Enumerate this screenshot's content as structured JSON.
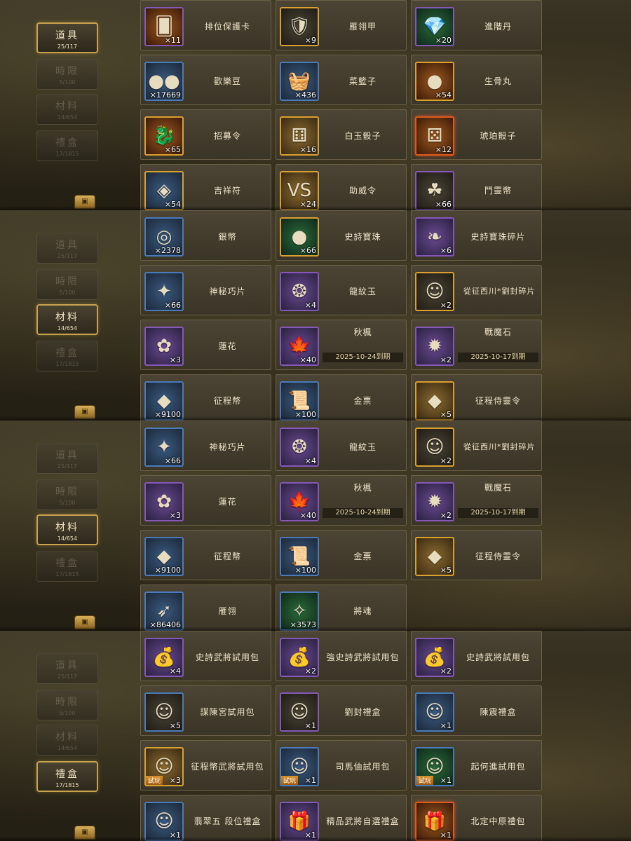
{
  "panels": [
    {
      "tabs": [
        {
          "label": "道具",
          "count": "25/117"
        },
        {
          "label": "時限",
          "count": "5/100"
        },
        {
          "label": "材料",
          "count": "14/654"
        },
        {
          "label": "禮盒",
          "count": "17/1815"
        }
      ],
      "active_tab": 0,
      "items": [
        {
          "name": "排位保護卡",
          "qty": "×11",
          "icon": "card-icon",
          "glyph": "🂠",
          "quality": "purple",
          "bg": "red"
        },
        {
          "name": "雁翎甲",
          "qty": "×9",
          "icon": "armor-icon",
          "glyph": "🛡",
          "quality": "gold",
          "bg": "dark"
        },
        {
          "name": "進階丹",
          "qty": "×20",
          "icon": "pill-icon",
          "glyph": "💎",
          "quality": "purple",
          "bg": "green"
        },
        {
          "name": "歡樂豆",
          "qty": "×17669",
          "icon": "beans-icon",
          "glyph": "●●",
          "quality": "blue",
          "bg": "blue"
        },
        {
          "name": "菜籃子",
          "qty": "×436",
          "icon": "basket-icon",
          "glyph": "🧺",
          "quality": "blue",
          "bg": "blue"
        },
        {
          "name": "生骨丸",
          "qty": "×54",
          "icon": "orb-icon",
          "glyph": "●",
          "quality": "gold",
          "bg": "red"
        },
        {
          "name": "招募令",
          "qty": "×65",
          "icon": "recruit-icon",
          "glyph": "🐉",
          "quality": "gold",
          "bg": "red"
        },
        {
          "name": "白玉骰子",
          "qty": "×16",
          "icon": "white-dice-icon",
          "glyph": "⚅",
          "quality": "gold",
          "bg": "gold"
        },
        {
          "name": "琥珀骰子",
          "qty": "×12",
          "icon": "amber-dice-icon",
          "glyph": "⚄",
          "quality": "red",
          "bg": "red"
        },
        {
          "name": "吉祥符",
          "qty": "×54",
          "icon": "charm-icon",
          "glyph": "◈",
          "quality": "gold",
          "bg": "blue"
        },
        {
          "name": "助威令",
          "qty": "×24",
          "icon": "vs-icon",
          "glyph": "VS",
          "quality": "gold",
          "bg": "gold"
        },
        {
          "name": "鬥靈幣",
          "qty": "×66",
          "icon": "spirit-coin-icon",
          "glyph": "☘",
          "quality": "purple",
          "bg": "dark"
        }
      ]
    },
    {
      "tabs": [
        {
          "label": "道具",
          "count": "25/117"
        },
        {
          "label": "時限",
          "count": "5/100"
        },
        {
          "label": "材料",
          "count": "14/654"
        },
        {
          "label": "禮盒",
          "count": "17/1815"
        }
      ],
      "active_tab": 2,
      "items": [
        {
          "name": "銀幣",
          "qty": "×2378",
          "icon": "silver-coin-icon",
          "glyph": "◎",
          "quality": "blue",
          "bg": "blue"
        },
        {
          "name": "史詩寶珠",
          "qty": "×66",
          "icon": "epic-orb-icon",
          "glyph": "●",
          "quality": "gold",
          "bg": "green"
        },
        {
          "name": "史詩寶珠碎片",
          "qty": "×6",
          "icon": "orb-shard-icon",
          "glyph": "❧",
          "quality": "purple",
          "bg": "purple"
        },
        {
          "name": "神秘巧片",
          "qty": "×66",
          "icon": "puzzle-icon",
          "glyph": "✦",
          "quality": "blue",
          "bg": "blue"
        },
        {
          "name": "龍紋玉",
          "qty": "×4",
          "icon": "jade-icon",
          "glyph": "❂",
          "quality": "purple",
          "bg": "purple"
        },
        {
          "name": "從征西川*劉封碎片",
          "qty": "×2",
          "icon": "hero-shard-icon",
          "glyph": "☺",
          "quality": "gold",
          "bg": "dark",
          "wrap": true
        },
        {
          "name": "蓮花",
          "qty": "×3",
          "icon": "lotus-icon",
          "glyph": "✿",
          "quality": "purple",
          "bg": "purple"
        },
        {
          "name": "秋楓",
          "qty": "×40",
          "icon": "maple-icon",
          "glyph": "🍁",
          "quality": "purple",
          "bg": "purple",
          "expire": "2025-10-24到期"
        },
        {
          "name": "戰魔石",
          "qty": "×2",
          "icon": "demon-stone-icon",
          "glyph": "✹",
          "quality": "purple",
          "bg": "purple",
          "expire": "2025-10-17到期"
        },
        {
          "name": "征程幣",
          "qty": "×9100",
          "icon": "journey-coin-icon",
          "glyph": "◆",
          "quality": "blue",
          "bg": "blue"
        },
        {
          "name": "金票",
          "qty": "×100",
          "icon": "gold-ticket-icon",
          "glyph": "📜",
          "quality": "blue",
          "bg": "blue"
        },
        {
          "name": "征程侍靈令",
          "qty": "×5",
          "icon": "spirit-token-icon",
          "glyph": "◆",
          "quality": "gold",
          "bg": "gold"
        }
      ]
    },
    {
      "tabs": [
        {
          "label": "道具",
          "count": "25/117"
        },
        {
          "label": "時限",
          "count": "5/100"
        },
        {
          "label": "材料",
          "count": "14/654"
        },
        {
          "label": "禮盒",
          "count": "17/1815"
        }
      ],
      "active_tab": 2,
      "items": [
        {
          "name": "神秘巧片",
          "qty": "×66",
          "icon": "puzzle-icon",
          "glyph": "✦",
          "quality": "blue",
          "bg": "blue"
        },
        {
          "name": "龍紋玉",
          "qty": "×4",
          "icon": "jade-icon",
          "glyph": "❂",
          "quality": "purple",
          "bg": "purple"
        },
        {
          "name": "從征西川*劉封碎片",
          "qty": "×2",
          "icon": "hero-shard-icon",
          "glyph": "☺",
          "quality": "gold",
          "bg": "dark",
          "wrap": true
        },
        {
          "name": "蓮花",
          "qty": "×3",
          "icon": "lotus-icon",
          "glyph": "✿",
          "quality": "purple",
          "bg": "purple"
        },
        {
          "name": "秋楓",
          "qty": "×40",
          "icon": "maple-icon",
          "glyph": "🍁",
          "quality": "purple",
          "bg": "purple",
          "expire": "2025-10-24到期"
        },
        {
          "name": "戰魔石",
          "qty": "×2",
          "icon": "demon-stone-icon",
          "glyph": "✹",
          "quality": "purple",
          "bg": "purple",
          "expire": "2025-10-17到期"
        },
        {
          "name": "征程幣",
          "qty": "×9100",
          "icon": "journey-coin-icon",
          "glyph": "◆",
          "quality": "blue",
          "bg": "blue"
        },
        {
          "name": "金票",
          "qty": "×100",
          "icon": "gold-ticket-icon",
          "glyph": "📜",
          "quality": "blue",
          "bg": "blue"
        },
        {
          "name": "征程侍靈令",
          "qty": "×5",
          "icon": "spirit-token-icon",
          "glyph": "◆",
          "quality": "gold",
          "bg": "gold"
        },
        {
          "name": "雁翎",
          "qty": "×86406",
          "icon": "feather-icon",
          "glyph": "➶",
          "quality": "blue",
          "bg": "blue"
        },
        {
          "name": "將魂",
          "qty": "×3573",
          "icon": "soul-icon",
          "glyph": "✧",
          "quality": "blue",
          "bg": "green"
        }
      ]
    },
    {
      "tabs": [
        {
          "label": "道具",
          "count": "25/117"
        },
        {
          "label": "時限",
          "count": "5/100"
        },
        {
          "label": "材料",
          "count": "14/654"
        },
        {
          "label": "禮盒",
          "count": "17/1815"
        }
      ],
      "active_tab": 3,
      "items": [
        {
          "name": "史詩武將試用包",
          "qty": "×4",
          "icon": "gold-bag-icon",
          "glyph": "💰",
          "quality": "purple",
          "bg": "purple"
        },
        {
          "name": "強史詩武將試用包",
          "qty": "×2",
          "icon": "pink-bag-icon",
          "glyph": "💰",
          "quality": "purple",
          "bg": "purple"
        },
        {
          "name": "史詩武將試用包",
          "qty": "×2",
          "icon": "gold-bag-icon",
          "glyph": "💰",
          "quality": "purple",
          "bg": "purple"
        },
        {
          "name": "謀陳宮試用包",
          "qty": "×5",
          "icon": "hero-portrait-icon",
          "glyph": "☺",
          "quality": "blue",
          "bg": "dark"
        },
        {
          "name": "劉封禮盒",
          "qty": "×1",
          "icon": "hero-portrait-icon",
          "glyph": "☺",
          "quality": "purple",
          "bg": "dark"
        },
        {
          "name": "陳震禮盒",
          "qty": "×1",
          "icon": "hero-portrait-icon",
          "glyph": "☺",
          "quality": "blue",
          "bg": "blue"
        },
        {
          "name": "征程幣武將試用包",
          "qty": "×3",
          "icon": "hero-portrait-icon",
          "glyph": "☺",
          "quality": "gold",
          "bg": "gold",
          "trial": "試玩"
        },
        {
          "name": "司馬伷試用包",
          "qty": "×1",
          "icon": "hero-portrait-icon",
          "glyph": "☺",
          "quality": "blue",
          "bg": "blue",
          "trial": "試玩"
        },
        {
          "name": "起何進試用包",
          "qty": "×1",
          "icon": "hero-portrait-icon",
          "glyph": "☺",
          "quality": "blue",
          "bg": "green",
          "trial": "試玩"
        },
        {
          "name": "翡翠五 段位禮盒",
          "qty": "×1",
          "icon": "hero-portrait-icon",
          "glyph": "☺",
          "quality": "blue",
          "bg": "blue"
        },
        {
          "name": "精品武將自選禮盒",
          "qty": "×1",
          "icon": "gift-box-icon",
          "glyph": "🎁",
          "quality": "purple",
          "bg": "purple"
        },
        {
          "name": "北定中原禮包",
          "qty": "×1",
          "icon": "gift-bag-icon",
          "glyph": "🎁",
          "quality": "red",
          "bg": "red"
        }
      ]
    }
  ]
}
